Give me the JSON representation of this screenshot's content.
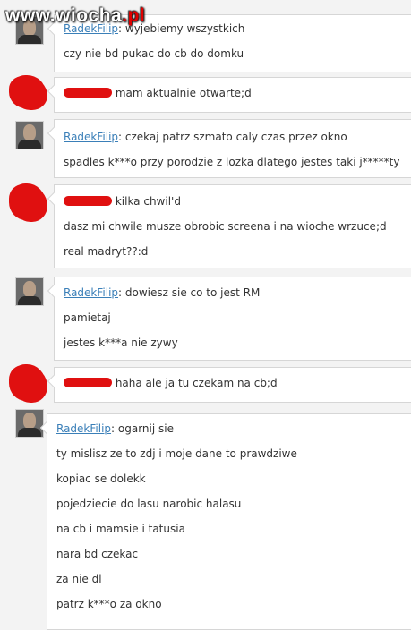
{
  "watermark": {
    "brand": "www.wiocha.pl"
  },
  "chat": {
    "messages": [
      {
        "sender": "RadekFilip",
        "lines": [
          "wyjebiemy wszystkich",
          "czy nie bd pukac do cb do domku"
        ]
      },
      {
        "sender": "",
        "lines": [
          "mam aktualnie otwarte;d"
        ]
      },
      {
        "sender": "RadekFilip",
        "lines": [
          "czekaj patrz szmato caly czas przez okno",
          "spadles k***o przy porodzie z lozka dlatego jestes taki j*****ty"
        ]
      },
      {
        "sender": "",
        "lines": [
          "kilka chwil'd",
          "dasz mi chwile musze obrobic screena i na wioche wrzuce;d",
          "real madryt??:d"
        ]
      },
      {
        "sender": "RadekFilip",
        "lines": [
          "dowiesz sie co to jest RM",
          "pamietaj",
          "jestes k***a nie zywy"
        ]
      },
      {
        "sender": "",
        "lines": [
          "haha ale ja tu czekam na cb;d"
        ]
      },
      {
        "sender": "RadekFilip",
        "lines": [
          "ogarnij sie",
          "ty mislisz ze to zdj i moje dane to prawdziwe",
          "kopiac se dolekk",
          "pojedziecie do lasu narobic halasu",
          "na cb i mamsie i tatusia",
          "nara bd czekac",
          "za nie dl",
          "patrz k***o za okno"
        ]
      }
    ]
  }
}
